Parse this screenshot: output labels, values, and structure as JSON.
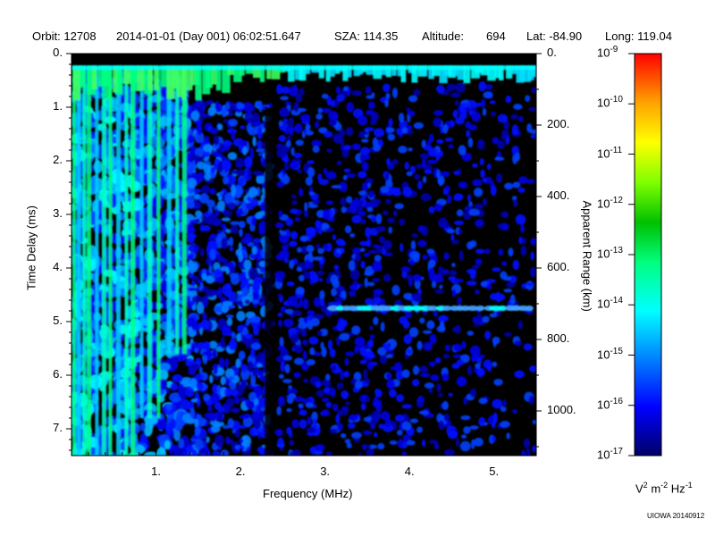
{
  "header": {
    "orbit": "Orbit: 12708",
    "datetime": "2014-01-01 (Day 001) 06:02:51.647",
    "sza": "SZA: 114.35",
    "altitude_label": "Altitude:",
    "altitude_value": "694",
    "lat": "Lat: -84.90",
    "long": "Long: 119.04"
  },
  "credit": "UIOWA 20140912",
  "chart_data": {
    "type": "heatmap",
    "title": "",
    "xlabel": "Frequency (MHz)",
    "ylabel": "Time Delay (ms)",
    "y2label": "Apparent Range (km)",
    "xlim": [
      0,
      5.5
    ],
    "ylim": [
      0,
      7.5
    ],
    "y2lim": [
      0,
      1125
    ],
    "xticks": [
      1,
      2,
      3,
      4,
      5
    ],
    "xtick_labels": [
      "1.",
      "2.",
      "3.",
      "4.",
      "5."
    ],
    "yticks": [
      0,
      1,
      2,
      3,
      4,
      5,
      6,
      7
    ],
    "ytick_labels": [
      "0.",
      "1.",
      "2.",
      "3.",
      "4.",
      "5.",
      "6.",
      "7."
    ],
    "y2ticks": [
      0,
      200,
      400,
      600,
      800,
      1000
    ],
    "y2tick_labels": [
      "0.",
      "200.",
      "400.",
      "600.",
      "800.",
      "1000."
    ],
    "colorbar": {
      "scale": "log",
      "range": [
        1e-17,
        1e-09
      ],
      "tick_labels": [
        {
          "base": "10",
          "exp": "-9"
        },
        {
          "base": "10",
          "exp": "-10"
        },
        {
          "base": "10",
          "exp": "-11"
        },
        {
          "base": "10",
          "exp": "-12"
        },
        {
          "base": "10",
          "exp": "-13"
        },
        {
          "base": "10",
          "exp": "-14"
        },
        {
          "base": "10",
          "exp": "-15"
        },
        {
          "base": "10",
          "exp": "-16"
        },
        {
          "base": "10",
          "exp": "-17"
        }
      ],
      "unit": {
        "v": "V",
        "v_exp": "2",
        "m": "m",
        "m_exp": "-2",
        "hz": "Hz",
        "hz_exp": "-1"
      },
      "colors": [
        "#000080",
        "#0000ff",
        "#00a0ff",
        "#00ffff",
        "#00ff80",
        "#00c000",
        "#80ff00",
        "#ffff00",
        "#ffa000",
        "#ff0000"
      ]
    },
    "features": {
      "surface_reflection_delay_ms": 0.25,
      "echo_trace_delay_ms": 4.75,
      "echo_trace_freq_range_mhz": [
        3.0,
        5.5
      ],
      "dark_gap_freq_mhz": 2.35
    }
  }
}
